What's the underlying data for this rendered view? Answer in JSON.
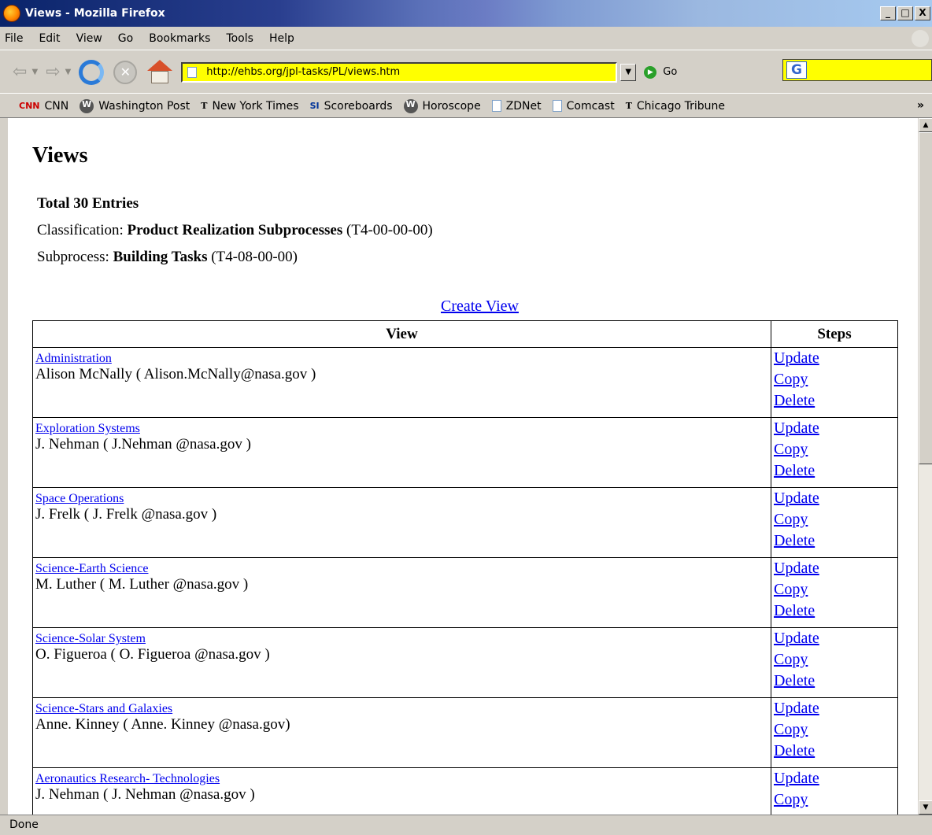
{
  "window": {
    "title": "Views - Mozilla Firefox",
    "min": "_",
    "max": "□",
    "close": "X"
  },
  "menu": [
    "File",
    "Edit",
    "View",
    "Go",
    "Bookmarks",
    "Tools",
    "Help"
  ],
  "nav": {
    "url": "http://ehbs.org/jpl-tasks/PL/views.htm",
    "go_label": "Go"
  },
  "bookmarks": [
    {
      "icon": "cnn-icon",
      "label": "CNN"
    },
    {
      "icon": "washington-post-icon",
      "label": "Washington Post"
    },
    {
      "icon": "nytimes-icon",
      "label": "New York Times"
    },
    {
      "icon": "si-icon",
      "label": "Scoreboards"
    },
    {
      "icon": "horoscope-icon",
      "label": "Horoscope"
    },
    {
      "icon": "page-icon",
      "label": "ZDNet"
    },
    {
      "icon": "page-icon",
      "label": "Comcast"
    },
    {
      "icon": "tribune-icon",
      "label": "Chicago Tribune"
    }
  ],
  "page": {
    "title": "Views",
    "total": "Total 30  Entries",
    "classification_label": "Classification: ",
    "classification_value": "Product Realization Subprocesses",
    "classification_code": " (T4-00-00-00)",
    "subprocess_label": "Subprocess:  ",
    "subprocess_value": "Building Tasks",
    "subprocess_code": "  (T4-08-00-00)",
    "create_view": "Create View",
    "table_headers": {
      "view": "View",
      "steps": "Steps"
    },
    "rows": [
      {
        "name": "Administration",
        "owner": "Alison McNally ( Alison.McNally@nasa.gov )"
      },
      {
        "name": "Exploration Systems ",
        "owner": "J. Nehman ( J.Nehman @nasa.gov )"
      },
      {
        "name": "Space Operations ",
        "owner": "J. Frelk ( J. Frelk @nasa.gov )"
      },
      {
        "name": "Science-Earth Science",
        "owner": "M. Luther ( M. Luther @nasa.gov )"
      },
      {
        "name": "Science-Solar System",
        "owner": "O. Figueroa ( O. Figueroa @nasa.gov )"
      },
      {
        "name": "Science-Stars and Galaxies",
        "owner": "Anne. Kinney ( Anne. Kinney @nasa.gov)"
      },
      {
        "name": "Aeronautics Research- Technologies ",
        "owner": "J. Nehman ( J. Nehman @nasa.gov )"
      }
    ],
    "step_links": [
      "Update",
      "Copy",
      "Delete"
    ]
  },
  "status": "Done"
}
